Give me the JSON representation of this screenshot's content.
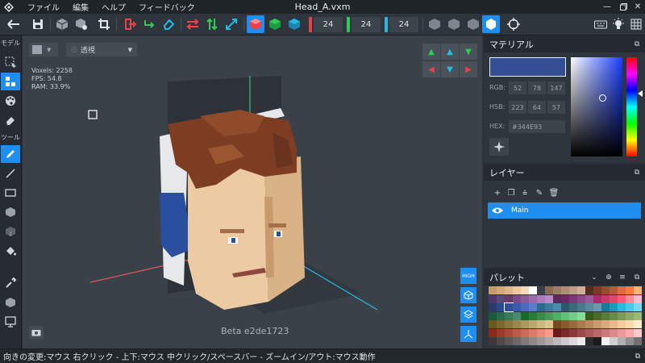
{
  "window": {
    "title": "Head_A.vxm",
    "menu": [
      "ファイル",
      "編集",
      "ヘルプ",
      "フィードバック"
    ]
  },
  "toolbar": {
    "counts": [
      {
        "value": "24",
        "color": "#e8434b"
      },
      {
        "value": "24",
        "color": "#2ecc55"
      },
      {
        "value": "24",
        "color": "#25b9e8"
      }
    ]
  },
  "left_tools": {
    "model_label": "モデル",
    "tool_label": "ツール"
  },
  "viewport": {
    "view_mode": "透視",
    "stats": [
      "Voxels: 2258",
      "FPS: 54.8",
      "RAM: 33.9%"
    ],
    "beta_label": "Beta e2de1723",
    "quality_label": "HIGH"
  },
  "material": {
    "title": "マテリアル",
    "color": "#344E93",
    "rgb_label": "RGB:",
    "rgb": [
      "52",
      "78",
      "147"
    ],
    "hsb_label": "HSB:",
    "hsb": [
      "223",
      "64",
      "57"
    ],
    "hex_label": "HEX:",
    "hex": "#344E93"
  },
  "layers": {
    "title": "レイヤー",
    "items": [
      {
        "name": "Main",
        "visible": true,
        "selected": true
      }
    ]
  },
  "palette": {
    "title": "パレット"
  },
  "status": {
    "text": "向きの変更:マウス 右クリック - 上下:マウス 中クリック/スペースバー - ズームイン/アウト:マウス動作"
  }
}
